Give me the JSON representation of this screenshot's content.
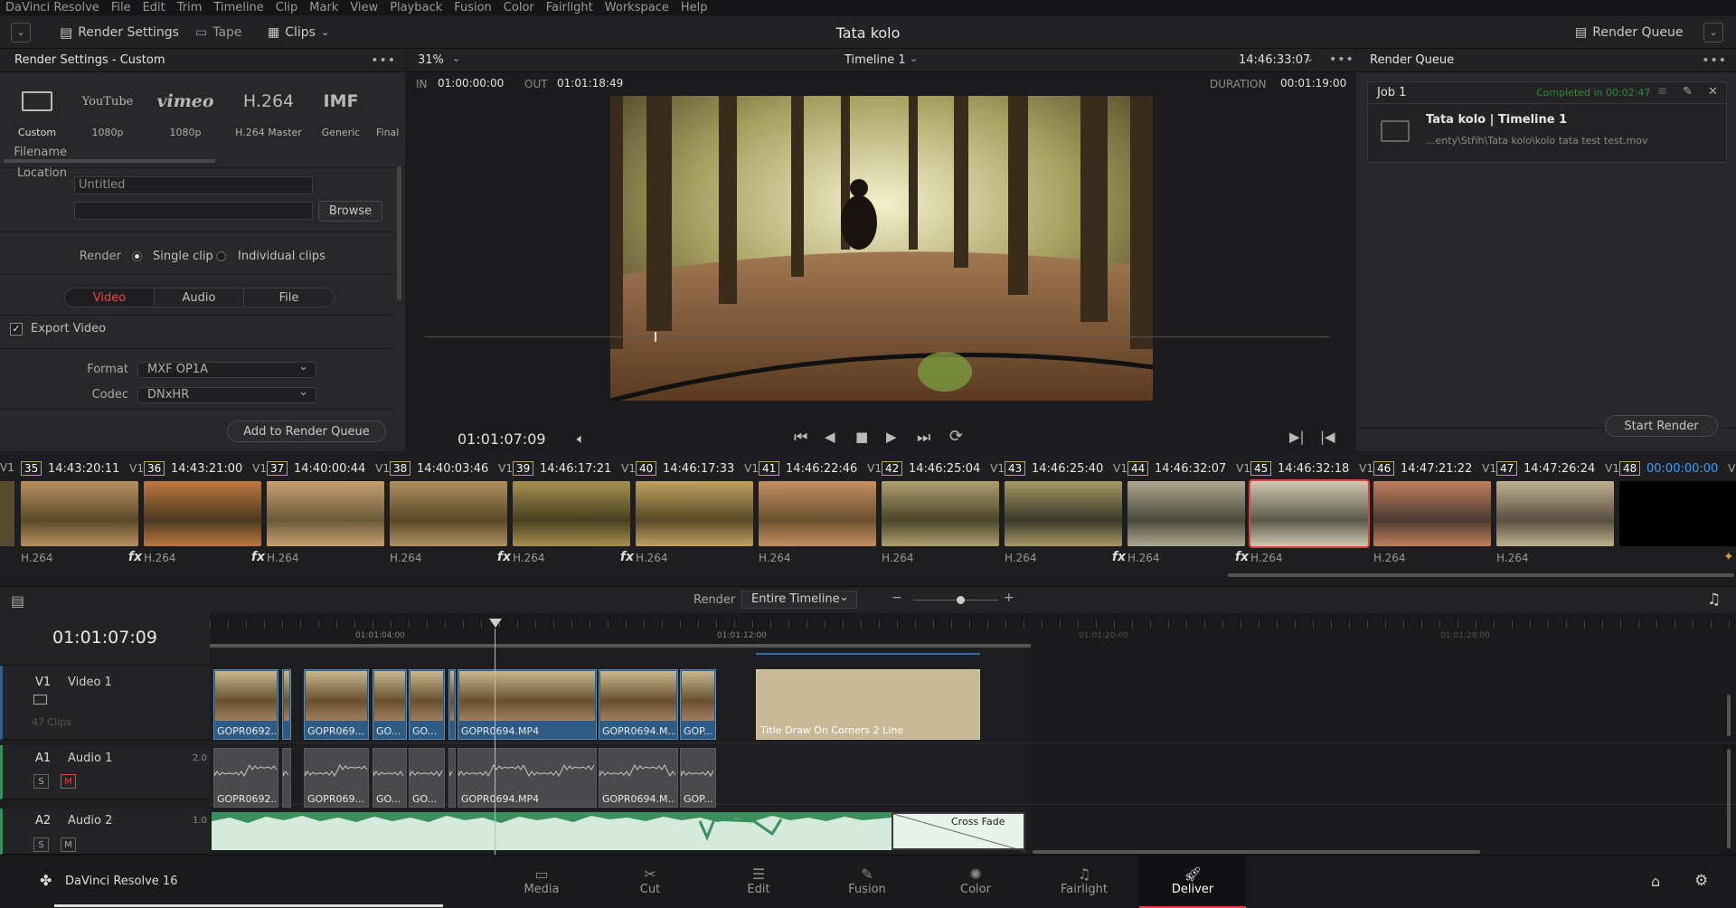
{
  "menu": [
    "DaVinci Resolve",
    "File",
    "Edit",
    "Trim",
    "Timeline",
    "Clip",
    "Mark",
    "View",
    "Playback",
    "Fusion",
    "Color",
    "Fairlight",
    "Workspace",
    "Help"
  ],
  "toolbar": {
    "render_settings": "Render Settings",
    "tape": "Tape",
    "clips": "Clips",
    "render_queue": "Render Queue",
    "project_title": "Tata kolo"
  },
  "render_settings": {
    "title": "Render Settings - Custom",
    "presets": [
      {
        "label": "Custom",
        "logo": "▭"
      },
      {
        "label": "1080p",
        "logo": "YouTube"
      },
      {
        "label": "1080p",
        "logo": "vimeo"
      },
      {
        "label": "H.264 Master",
        "logo": "H.264"
      },
      {
        "label": "Generic",
        "logo": "IMF"
      },
      {
        "label": "Final",
        "logo": ""
      }
    ],
    "filename_label": "Filename",
    "filename_value": "Untitled",
    "location_label": "Location",
    "location_value": "",
    "browse": "Browse",
    "render_label": "Render",
    "single_clip": "Single clip",
    "individual_clips": "Individual clips",
    "tabs": [
      "Video",
      "Audio",
      "File"
    ],
    "export_video": "Export Video",
    "format_label": "Format",
    "format_value": "MXF OP1A",
    "codec_label": "Codec",
    "codec_value": "DNxHR",
    "add_to_queue": "Add to Render Queue"
  },
  "viewer": {
    "zoom": "31%",
    "timeline_name": "Timeline 1",
    "timecode_top": "14:46:33:07",
    "in_label": "IN",
    "in_value": "01:00:00:00",
    "out_label": "OUT",
    "out_value": "01:01:18:49",
    "duration_label": "DURATION",
    "duration_value": "00:01:19:00",
    "current_tc": "01:01:07:09"
  },
  "render_queue": {
    "title": "Render Queue",
    "job": "Job 1",
    "status": "Completed in 00:02:47",
    "job_title": "Tata kolo | Timeline 1",
    "job_path": "...enty\\Střih\\Tata kolo\\kolo tata test test.mov",
    "start_render": "Start Render"
  },
  "thumbnails": [
    {
      "num": "35",
      "tc": "14:43:20:11",
      "track": "V1",
      "codec": "H.264",
      "fx": "fx"
    },
    {
      "num": "36",
      "tc": "14:43:21:00",
      "track": "V1",
      "codec": "H.264",
      "fx": "fx"
    },
    {
      "num": "37",
      "tc": "14:40:00:44",
      "track": "V1",
      "codec": "H.264",
      "fx": ""
    },
    {
      "num": "38",
      "tc": "14:40:03:46",
      "track": "V1",
      "codec": "H.264",
      "fx": "fx"
    },
    {
      "num": "39",
      "tc": "14:46:17:21",
      "track": "V1",
      "codec": "H.264",
      "fx": "fx"
    },
    {
      "num": "40",
      "tc": "14:46:17:33",
      "track": "V1",
      "codec": "H.264",
      "fx": ""
    },
    {
      "num": "41",
      "tc": "14:46:22:46",
      "track": "V1",
      "codec": "H.264",
      "fx": ""
    },
    {
      "num": "42",
      "tc": "14:46:25:04",
      "track": "V1",
      "codec": "H.264",
      "fx": ""
    },
    {
      "num": "43",
      "tc": "14:46:25:40",
      "track": "V1",
      "codec": "H.264",
      "fx": "fx"
    },
    {
      "num": "44",
      "tc": "14:46:32:07",
      "track": "V1",
      "codec": "H.264",
      "fx": "fx"
    },
    {
      "num": "45",
      "tc": "14:46:32:18",
      "track": "V1",
      "codec": "H.264",
      "fx": ""
    },
    {
      "num": "46",
      "tc": "14:47:21:22",
      "track": "V1",
      "codec": "H.264",
      "fx": ""
    },
    {
      "num": "47",
      "tc": "14:47:26:24",
      "track": "V1",
      "codec": "H.264",
      "fx": ""
    },
    {
      "num": "48",
      "tc": "00:00:00:00",
      "track": "V1",
      "codec": "",
      "fx": ""
    }
  ],
  "timeline_bar": {
    "render_label": "Render",
    "render_value": "Entire Timeline"
  },
  "timeline": {
    "timecode": "01:01:07:09",
    "ruler": [
      "01:01:04:00",
      "01:01:12:00",
      "01:01:20:00",
      "01:01:28:00"
    ],
    "tracks": [
      {
        "id": "V1",
        "name": "Video 1",
        "info": "47 Clips"
      },
      {
        "id": "A1",
        "name": "Audio 1",
        "level": "2.0"
      },
      {
        "id": "A2",
        "name": "Audio 2",
        "level": "1.0"
      }
    ],
    "video_clips": [
      "GOPR0692....",
      "GOPR069...",
      "GO...",
      "GO...",
      "GOPR0694.MP4",
      "GOPR0694.M...",
      "GOP..."
    ],
    "title_clip": "Title Draw On Corners 2 Line",
    "audio_clips": [
      "GOPR0692....",
      "GOPR069...",
      "GO...",
      "GO...",
      "GOPR0694.MP4",
      "GOPR0694.M...",
      "GOP..."
    ],
    "cross_fade": "Cross Fade",
    "solo": "S",
    "mute": "M"
  },
  "pages": [
    {
      "name": "Media",
      "icon": "media-icon"
    },
    {
      "name": "Cut",
      "icon": "cut-icon"
    },
    {
      "name": "Edit",
      "icon": "edit-icon"
    },
    {
      "name": "Fusion",
      "icon": "fusion-icon"
    },
    {
      "name": "Color",
      "icon": "color-icon"
    },
    {
      "name": "Fairlight",
      "icon": "fairlight-icon"
    },
    {
      "name": "Deliver",
      "icon": "deliver-icon"
    }
  ],
  "app_name": "DaVinci Resolve 16",
  "colors": {
    "accent_red": "#e04040",
    "clip_blue": "#2e5b84",
    "audio_green": "#3a8f5c",
    "title_tan": "#c9b896"
  }
}
